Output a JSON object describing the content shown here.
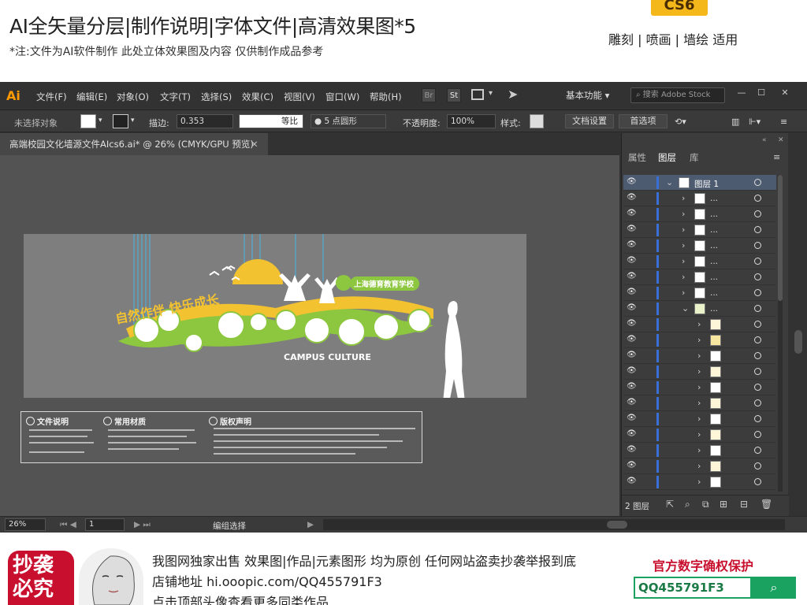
{
  "top_banner": {
    "headline": "AI全矢量分层|制作说明|字体文件|高清效果图*5",
    "note": "*注:文件为AI软件制作 此处立体效果图及内容 仅供制作成品参考",
    "cs_badge": "CS6",
    "usage": "雕刻 | 喷画 | 墙绘 适用"
  },
  "menubar": {
    "logo": "Ai",
    "items": [
      "文件(F)",
      "编辑(E)",
      "对象(O)",
      "文字(T)",
      "选择(S)",
      "效果(C)",
      "视图(V)",
      "窗口(W)",
      "帮助(H)"
    ],
    "btn_br": "Br",
    "btn_st": "St",
    "workspace": "基本功能",
    "search_placeholder": "搜索 Adobe Stock"
  },
  "control_bar": {
    "selection": "未选择对象",
    "stroke_label": "描边:",
    "stroke_value": "0.353",
    "stroke_profile": "等比",
    "brush_value": "5",
    "brush_shape": "点圆形",
    "opacity_label": "不透明度:",
    "opacity_value": "100%",
    "style_label": "样式:",
    "doc_settings": "文档设置",
    "preferences": "首选项"
  },
  "document": {
    "tab_title": "高端校园文化墙源文件AIcs6.ai* @ 26% (CMYK/GPU 预览)",
    "zoom": "26%",
    "page": "1",
    "status": "编组选择"
  },
  "artwork": {
    "slogan": "自然作伴 快乐成长",
    "school": "上海德育教育学校",
    "campus": "CAMPUS CULTURE",
    "accent_yellow": "#f2c230",
    "accent_green": "#8dc63f"
  },
  "info_panel": {
    "sections": [
      "文件说明",
      "常用材质",
      "版权声明"
    ]
  },
  "layers": {
    "tabs": [
      "属性",
      "图层",
      "库"
    ],
    "top_layer": "图层 1",
    "sub_label": "...",
    "footer": "2 图层"
  },
  "bottom_banner": {
    "stamp_line1": "抄袭",
    "stamp_line2": "必究",
    "line1": "我图网独家出售 效果图|作品|元素图形 均为原创 任何网站盗卖抄袭举报到底",
    "line2": "店铺地址 hi.ooopic.com/QQ455791F3",
    "line3": "点击顶部头像查看更多同类作品",
    "protect_title": "官方数字确权保护",
    "qq_id": "QQ455791F3"
  }
}
